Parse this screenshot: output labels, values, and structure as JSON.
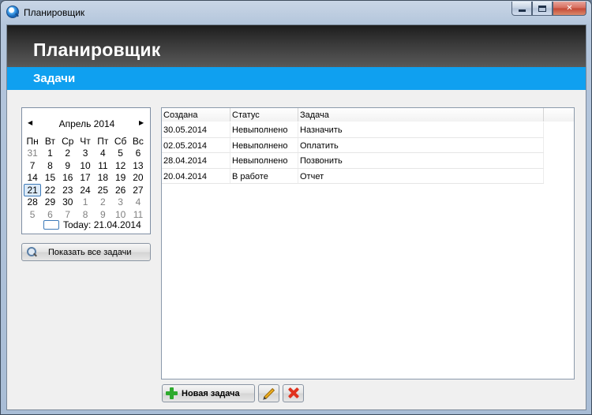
{
  "window": {
    "title": "Планировщик",
    "controls": {
      "minimize": "minimize-icon",
      "maximize": "maximize-icon",
      "close": "✕"
    }
  },
  "header": {
    "title": "Планировщик"
  },
  "subheader": {
    "title": "Задачи"
  },
  "calendar": {
    "month": "Апрель 2014",
    "prev": "◀",
    "next": "▶",
    "weekdays": [
      "Пн",
      "Вт",
      "Ср",
      "Чт",
      "Пт",
      "Сб",
      "Вс"
    ],
    "weeks": [
      [
        "31",
        "1",
        "2",
        "3",
        "4",
        "5",
        "6"
      ],
      [
        "7",
        "8",
        "9",
        "10",
        "11",
        "12",
        "13"
      ],
      [
        "14",
        "15",
        "16",
        "17",
        "18",
        "19",
        "20"
      ],
      [
        "21",
        "22",
        "23",
        "24",
        "25",
        "26",
        "27"
      ],
      [
        "28",
        "29",
        "30",
        "1",
        "2",
        "3",
        "4"
      ],
      [
        "5",
        "6",
        "7",
        "8",
        "9",
        "10",
        "11"
      ]
    ],
    "selected_day": "21",
    "today_label": "Today: 21.04.2014"
  },
  "sidebar": {
    "show_all_label": "Показать все задачи"
  },
  "tasks": {
    "columns": [
      "Создана",
      "Статус",
      "Задача",
      ""
    ],
    "rows": [
      {
        "created": "30.05.2014",
        "status": "Невыполнено",
        "task": "Назначить"
      },
      {
        "created": "02.05.2014",
        "status": "Невыполнено",
        "task": "Оплатить"
      },
      {
        "created": "28.04.2014",
        "status": "Невыполнено",
        "task": "Позвонить"
      },
      {
        "created": "20.04.2014",
        "status": "В работе",
        "task": "Отчет"
      }
    ]
  },
  "toolbar": {
    "new_task_label": "Новая задача"
  },
  "colors": {
    "accent": "#0fa0f0",
    "header_dark": "#2a2a2a",
    "add_green": "#2eaa2e",
    "delete_red": "#e0321e"
  }
}
